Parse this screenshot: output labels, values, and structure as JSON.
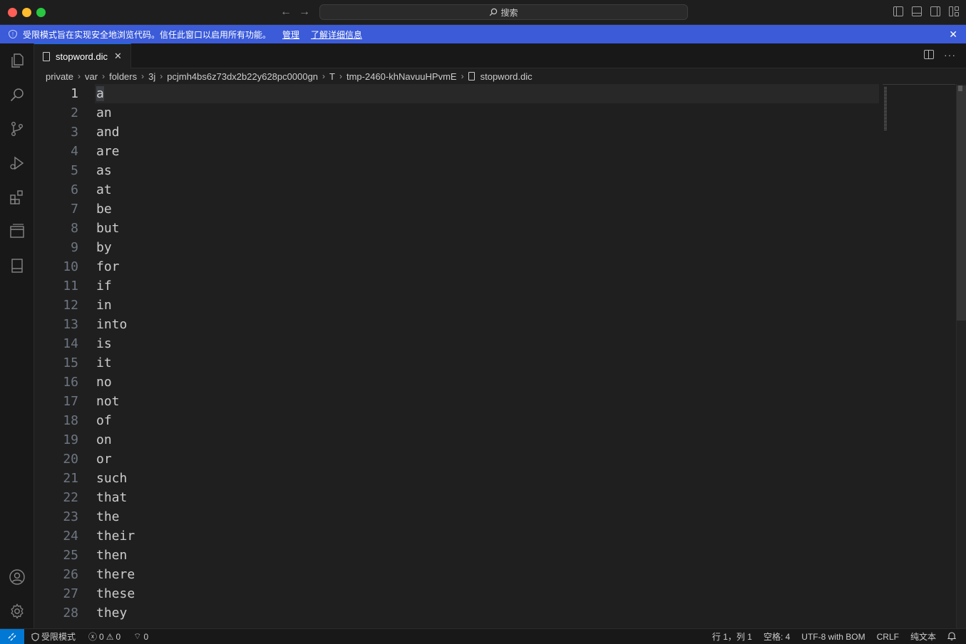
{
  "titlebar": {
    "search_placeholder": "搜索"
  },
  "banner": {
    "message": "受限模式旨在实现安全地浏览代码。信任此窗口以启用所有功能。",
    "manage_link": "管理",
    "learn_more_link": "了解详细信息"
  },
  "tab": {
    "label": "stopword.dic"
  },
  "breadcrumb": [
    "private",
    "var",
    "folders",
    "3j",
    "pcjmh4bs6z73dx2b22y628pc0000gn",
    "T",
    "tmp-2460-khNavuuHPvmE",
    "stopword.dic"
  ],
  "editor": {
    "line_numbers": [
      "1",
      "2",
      "3",
      "4",
      "5",
      "6",
      "7",
      "8",
      "9",
      "10",
      "11",
      "12",
      "13",
      "14",
      "15",
      "16",
      "17",
      "18",
      "19",
      "20",
      "21",
      "22",
      "23",
      "24",
      "25",
      "26",
      "27",
      "28"
    ],
    "lines": [
      "a",
      "an",
      "and",
      "are",
      "as",
      "at",
      "be",
      "but",
      "by",
      "for",
      "if",
      "in",
      "into",
      "is",
      "it",
      "no",
      "not",
      "of",
      "on",
      "or",
      "such",
      "that",
      "the",
      "their",
      "then",
      "there",
      "these",
      "they"
    ]
  },
  "statusbar": {
    "restricted_mode": "受限模式",
    "errors": "0",
    "warnings": "0",
    "ports": "0",
    "position": "行 1，列 1",
    "indent": "空格: 4",
    "encoding": "UTF-8 with BOM",
    "eol": "CRLF",
    "language": "纯文本"
  },
  "colors": {
    "banner": "#3b5bd9",
    "remote": "#0078d4",
    "editor_bg": "#1f1f1f"
  }
}
